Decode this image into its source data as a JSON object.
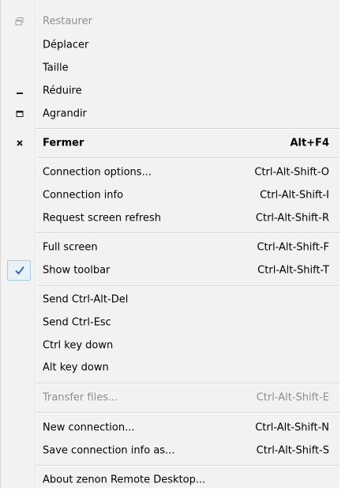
{
  "menu": {
    "items": [
      {
        "label": "Restaurer",
        "shortcut": "",
        "icon": "restore-icon"
      },
      {
        "label": "Déplacer",
        "shortcut": ""
      },
      {
        "label": "Taille",
        "shortcut": ""
      },
      {
        "label": "Réduire",
        "shortcut": "",
        "icon": "minimize-icon"
      },
      {
        "label": "Agrandir",
        "shortcut": "",
        "icon": "maximize-icon"
      },
      {
        "label": "Fermer",
        "shortcut": "Alt+F4",
        "icon": "close-icon"
      },
      {
        "label": "Connection options...",
        "shortcut": "Ctrl-Alt-Shift-O"
      },
      {
        "label": "Connection info",
        "shortcut": "Ctrl-Alt-Shift-I"
      },
      {
        "label": "Request screen refresh",
        "shortcut": "Ctrl-Alt-Shift-R"
      },
      {
        "label": "Full screen",
        "shortcut": "Ctrl-Alt-Shift-F"
      },
      {
        "label": "Show toolbar",
        "shortcut": "Ctrl-Alt-Shift-T",
        "checked": true
      },
      {
        "label": "Send Ctrl-Alt-Del",
        "shortcut": ""
      },
      {
        "label": "Send Ctrl-Esc",
        "shortcut": ""
      },
      {
        "label": "Ctrl key down",
        "shortcut": ""
      },
      {
        "label": "Alt key down",
        "shortcut": ""
      },
      {
        "label": "Transfer files...",
        "shortcut": "Ctrl-Alt-Shift-E"
      },
      {
        "label": "New connection...",
        "shortcut": "Ctrl-Alt-Shift-N"
      },
      {
        "label": "Save connection info as...",
        "shortcut": "Ctrl-Alt-Shift-S"
      },
      {
        "label": "About zenon Remote Desktop...",
        "shortcut": ""
      }
    ]
  },
  "colors": {
    "menu_background": "#f2f2f2",
    "disabled_text": "#8d8d8d",
    "check_mark": "#1e5fa8"
  }
}
